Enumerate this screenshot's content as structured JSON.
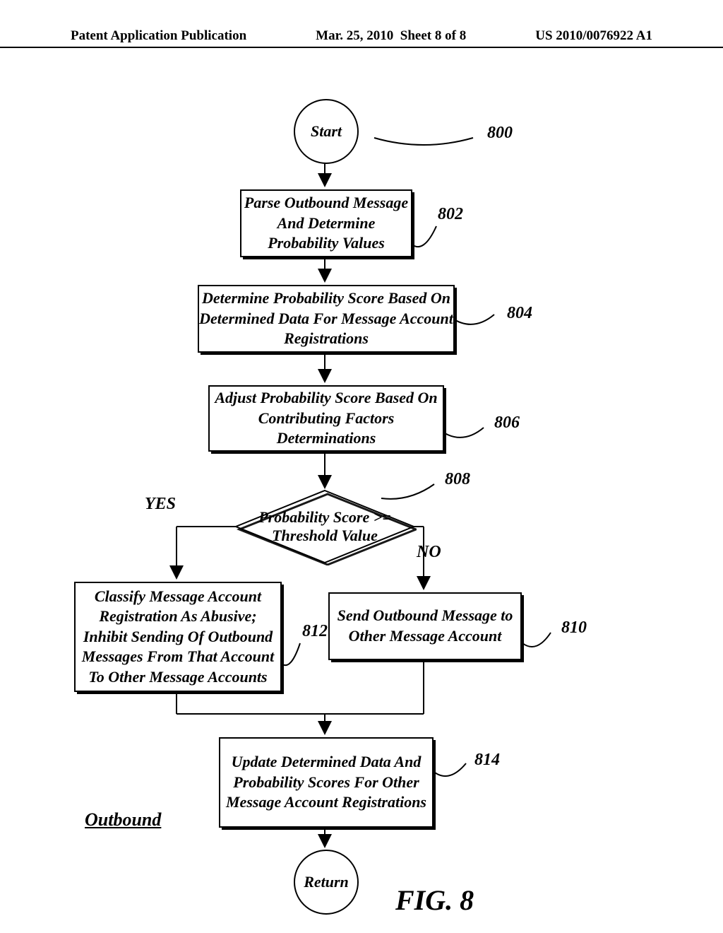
{
  "header": {
    "pub": "Patent Application Publication",
    "date": "Mar. 25, 2010",
    "sheet": "Sheet 8 of 8",
    "docnum": "US 2010/0076922 A1"
  },
  "nodes": {
    "start": "Start",
    "n802": "Parse Outbound Message And Determine Probability Values",
    "n804": "Determine Probability Score Based On Determined Data For Message Account Registrations",
    "n806": "Adjust Probability Score Based On Contributing Factors Determinations",
    "n808": "Probability Score >= Threshold Value",
    "n810": "Send Outbound Message to Other Message Account",
    "n812": "Classify Message Account Registration As Abusive; Inhibit Sending Of Outbound Messages From That Account To Other Message Accounts",
    "n814": "Update Determined Data And Probability Scores For Other Message Account Registrations",
    "return": "Return"
  },
  "nums": {
    "r800": "800",
    "r802": "802",
    "r804": "804",
    "r806": "806",
    "r808": "808",
    "r810": "810",
    "r812": "812",
    "r814": "814"
  },
  "branch": {
    "yes": "YES",
    "no": "NO"
  },
  "section": "Outbound",
  "fig": "FIG. 8"
}
